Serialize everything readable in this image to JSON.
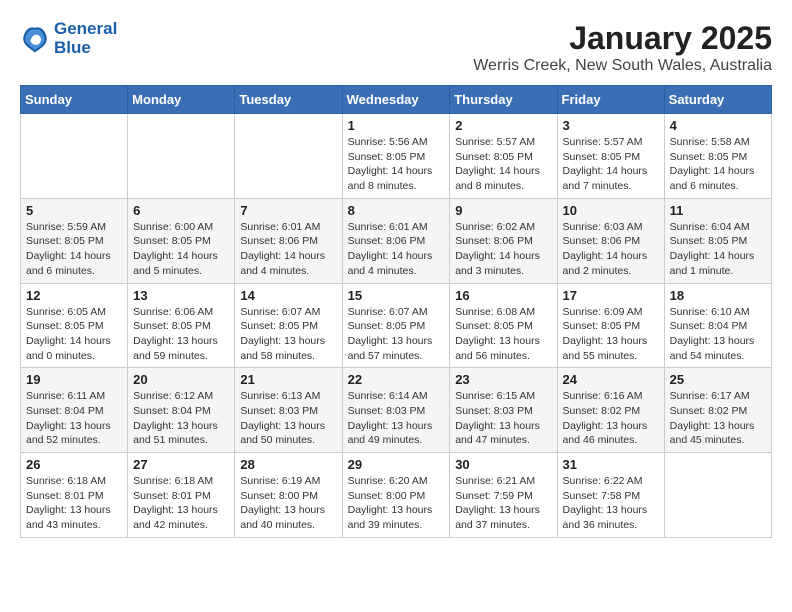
{
  "header": {
    "logo_line1": "General",
    "logo_line2": "Blue",
    "month": "January 2025",
    "location": "Werris Creek, New South Wales, Australia"
  },
  "days_of_week": [
    "Sunday",
    "Monday",
    "Tuesday",
    "Wednesday",
    "Thursday",
    "Friday",
    "Saturday"
  ],
  "weeks": [
    [
      {
        "day": "",
        "info": ""
      },
      {
        "day": "",
        "info": ""
      },
      {
        "day": "",
        "info": ""
      },
      {
        "day": "1",
        "info": "Sunrise: 5:56 AM\nSunset: 8:05 PM\nDaylight: 14 hours\nand 8 minutes."
      },
      {
        "day": "2",
        "info": "Sunrise: 5:57 AM\nSunset: 8:05 PM\nDaylight: 14 hours\nand 8 minutes."
      },
      {
        "day": "3",
        "info": "Sunrise: 5:57 AM\nSunset: 8:05 PM\nDaylight: 14 hours\nand 7 minutes."
      },
      {
        "day": "4",
        "info": "Sunrise: 5:58 AM\nSunset: 8:05 PM\nDaylight: 14 hours\nand 6 minutes."
      }
    ],
    [
      {
        "day": "5",
        "info": "Sunrise: 5:59 AM\nSunset: 8:05 PM\nDaylight: 14 hours\nand 6 minutes."
      },
      {
        "day": "6",
        "info": "Sunrise: 6:00 AM\nSunset: 8:05 PM\nDaylight: 14 hours\nand 5 minutes."
      },
      {
        "day": "7",
        "info": "Sunrise: 6:01 AM\nSunset: 8:06 PM\nDaylight: 14 hours\nand 4 minutes."
      },
      {
        "day": "8",
        "info": "Sunrise: 6:01 AM\nSunset: 8:06 PM\nDaylight: 14 hours\nand 4 minutes."
      },
      {
        "day": "9",
        "info": "Sunrise: 6:02 AM\nSunset: 8:06 PM\nDaylight: 14 hours\nand 3 minutes."
      },
      {
        "day": "10",
        "info": "Sunrise: 6:03 AM\nSunset: 8:06 PM\nDaylight: 14 hours\nand 2 minutes."
      },
      {
        "day": "11",
        "info": "Sunrise: 6:04 AM\nSunset: 8:05 PM\nDaylight: 14 hours\nand 1 minute."
      }
    ],
    [
      {
        "day": "12",
        "info": "Sunrise: 6:05 AM\nSunset: 8:05 PM\nDaylight: 14 hours\nand 0 minutes."
      },
      {
        "day": "13",
        "info": "Sunrise: 6:06 AM\nSunset: 8:05 PM\nDaylight: 13 hours\nand 59 minutes."
      },
      {
        "day": "14",
        "info": "Sunrise: 6:07 AM\nSunset: 8:05 PM\nDaylight: 13 hours\nand 58 minutes."
      },
      {
        "day": "15",
        "info": "Sunrise: 6:07 AM\nSunset: 8:05 PM\nDaylight: 13 hours\nand 57 minutes."
      },
      {
        "day": "16",
        "info": "Sunrise: 6:08 AM\nSunset: 8:05 PM\nDaylight: 13 hours\nand 56 minutes."
      },
      {
        "day": "17",
        "info": "Sunrise: 6:09 AM\nSunset: 8:05 PM\nDaylight: 13 hours\nand 55 minutes."
      },
      {
        "day": "18",
        "info": "Sunrise: 6:10 AM\nSunset: 8:04 PM\nDaylight: 13 hours\nand 54 minutes."
      }
    ],
    [
      {
        "day": "19",
        "info": "Sunrise: 6:11 AM\nSunset: 8:04 PM\nDaylight: 13 hours\nand 52 minutes."
      },
      {
        "day": "20",
        "info": "Sunrise: 6:12 AM\nSunset: 8:04 PM\nDaylight: 13 hours\nand 51 minutes."
      },
      {
        "day": "21",
        "info": "Sunrise: 6:13 AM\nSunset: 8:03 PM\nDaylight: 13 hours\nand 50 minutes."
      },
      {
        "day": "22",
        "info": "Sunrise: 6:14 AM\nSunset: 8:03 PM\nDaylight: 13 hours\nand 49 minutes."
      },
      {
        "day": "23",
        "info": "Sunrise: 6:15 AM\nSunset: 8:03 PM\nDaylight: 13 hours\nand 47 minutes."
      },
      {
        "day": "24",
        "info": "Sunrise: 6:16 AM\nSunset: 8:02 PM\nDaylight: 13 hours\nand 46 minutes."
      },
      {
        "day": "25",
        "info": "Sunrise: 6:17 AM\nSunset: 8:02 PM\nDaylight: 13 hours\nand 45 minutes."
      }
    ],
    [
      {
        "day": "26",
        "info": "Sunrise: 6:18 AM\nSunset: 8:01 PM\nDaylight: 13 hours\nand 43 minutes."
      },
      {
        "day": "27",
        "info": "Sunrise: 6:18 AM\nSunset: 8:01 PM\nDaylight: 13 hours\nand 42 minutes."
      },
      {
        "day": "28",
        "info": "Sunrise: 6:19 AM\nSunset: 8:00 PM\nDaylight: 13 hours\nand 40 minutes."
      },
      {
        "day": "29",
        "info": "Sunrise: 6:20 AM\nSunset: 8:00 PM\nDaylight: 13 hours\nand 39 minutes."
      },
      {
        "day": "30",
        "info": "Sunrise: 6:21 AM\nSunset: 7:59 PM\nDaylight: 13 hours\nand 37 minutes."
      },
      {
        "day": "31",
        "info": "Sunrise: 6:22 AM\nSunset: 7:58 PM\nDaylight: 13 hours\nand 36 minutes."
      },
      {
        "day": "",
        "info": ""
      }
    ]
  ]
}
